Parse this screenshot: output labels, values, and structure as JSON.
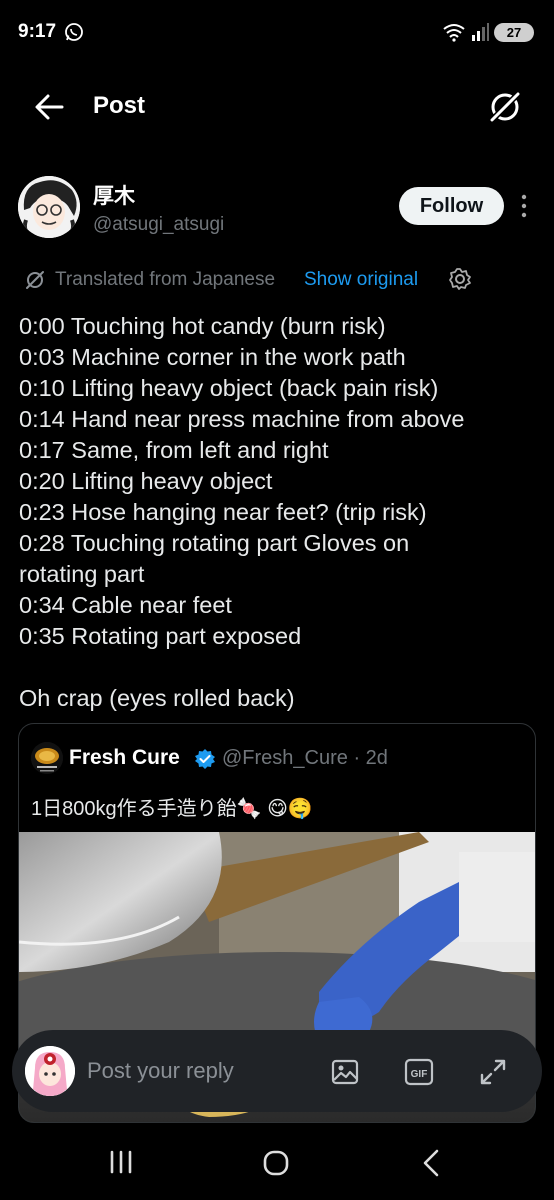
{
  "status_bar": {
    "time": "9:17",
    "battery": "27"
  },
  "header": {
    "title": "Post"
  },
  "author": {
    "name": "厚木",
    "handle": "@atsugi_atsugi",
    "follow_label": "Follow"
  },
  "translation": {
    "label": "Translated from Japanese",
    "show_original": "Show original"
  },
  "post": {
    "lines": [
      "0:00 Touching hot candy (burn risk)",
      "0:03 Machine corner in the work path",
      "0:10 Lifting heavy object (back pain risk)",
      "0:14 Hand near press machine from above",
      "0:17 Same, from left and right",
      "0:20 Lifting heavy object",
      "0:23 Hose hanging near feet? (trip risk)",
      "0:28 Touching rotating part  Gloves on",
      "rotating part",
      "0:34 Cable near feet",
      "0:35 Rotating part exposed"
    ],
    "closing": "Oh crap (eyes rolled back)"
  },
  "quote": {
    "name": "Fresh Cure",
    "handle": "@Fresh_Cure · 2d",
    "text": "1日800kg作る手造り飴🍬 😋🤤"
  },
  "reply": {
    "placeholder": "Post your reply"
  },
  "colors": {
    "accent": "#1d9bf0",
    "background": "#000000",
    "follow_bg": "#eff3f4",
    "reply_bar": "#202327"
  },
  "icons": [
    "whatsapp-icon",
    "wifi-icon",
    "signal-icon",
    "back-arrow-icon",
    "grok-icon",
    "more-vertical-icon",
    "translate-icon",
    "settings-gear-icon",
    "verified-badge-icon",
    "image-icon",
    "gif-icon",
    "expand-icon",
    "recents-icon",
    "home-icon",
    "nav-back-icon"
  ]
}
